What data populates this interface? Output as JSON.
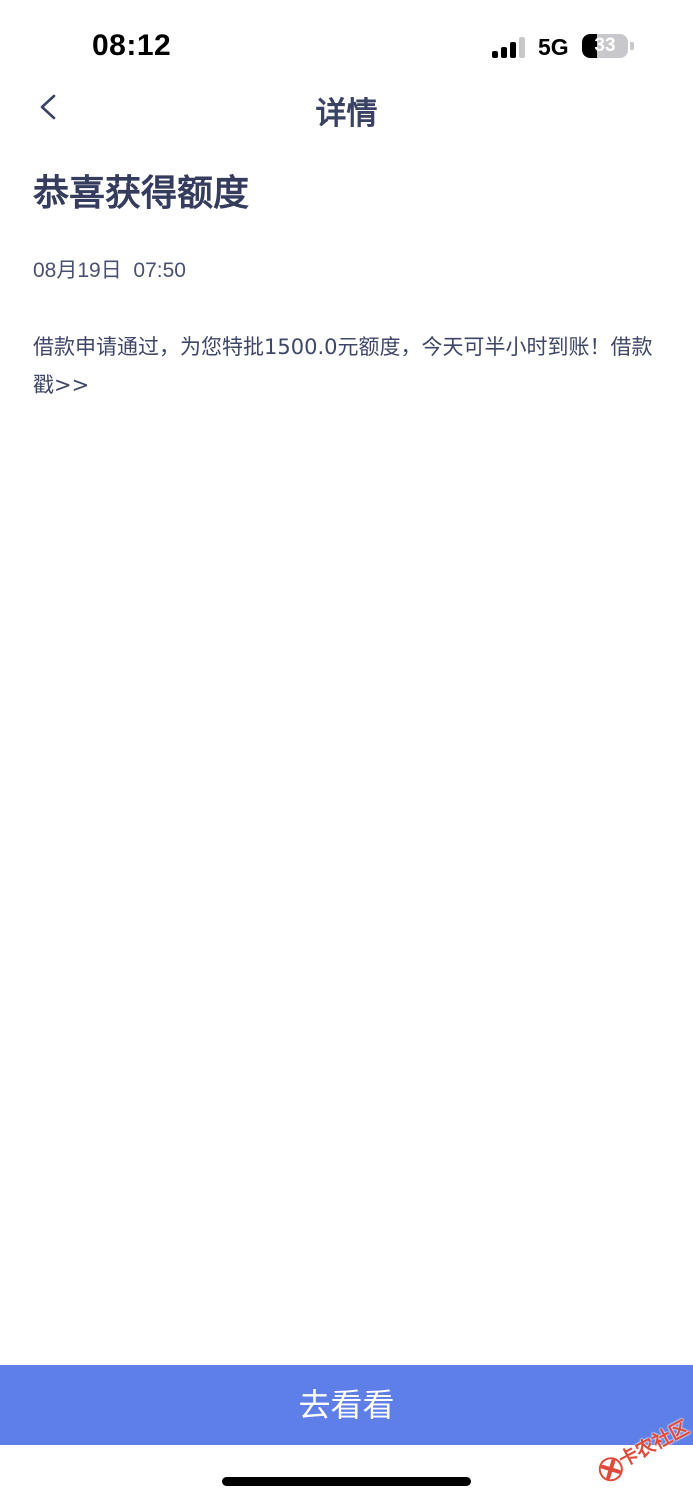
{
  "status_bar": {
    "time": "08:12",
    "network": "5G",
    "battery_level": "33",
    "battery_fraction": 0.33
  },
  "nav": {
    "title": "详情",
    "back_icon": "chevron-left-icon"
  },
  "message": {
    "title": "恭喜获得额度",
    "time": "08月19日  07:50",
    "body": "借款申请通过，为您特批1500.0元额度，今天可半小时到账！借款戳>>"
  },
  "action": {
    "button_label": "去看看"
  },
  "watermark": {
    "text": "卡农社区"
  },
  "colors": {
    "accent": "#5e7fe8",
    "title_text": "#353c5e",
    "body_text": "#3f4768",
    "watermark": "#e04a3a"
  }
}
